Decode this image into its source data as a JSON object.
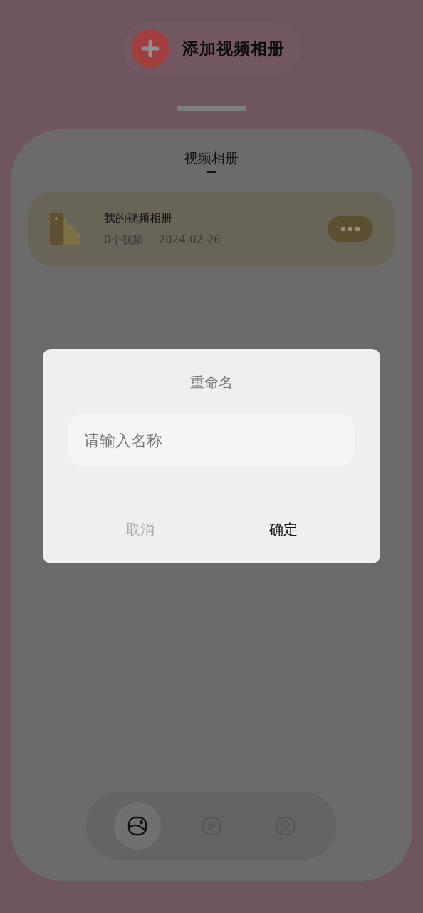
{
  "add_button": {
    "label": "添加视频相册"
  },
  "page_tabs": [
    {
      "label": "视频相册",
      "selected": true
    }
  ],
  "albums": [
    {
      "name": "我的视频相册",
      "count": "0个视频",
      "date": "2024-02-26"
    }
  ],
  "dialog": {
    "title": "重命名",
    "input": {
      "placeholder": "请输入名称"
    },
    "cancel": "取消",
    "confirm": "确定"
  },
  "nav": [
    {
      "kind": "photo",
      "selected": true
    },
    {
      "kind": "video",
      "selected": false
    },
    {
      "kind": "profile",
      "selected": false
    }
  ]
}
